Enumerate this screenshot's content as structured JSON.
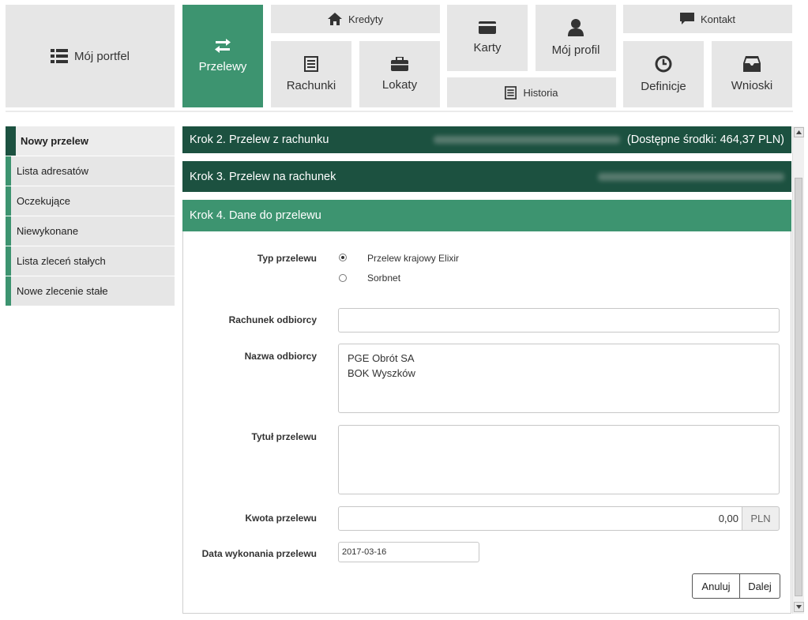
{
  "nav": {
    "portfolio": "Mój portfel",
    "transfers": "Przelewy",
    "credits": "Kredyty",
    "accounts": "Rachunki",
    "deposits": "Lokaty",
    "cards": "Karty",
    "history": "Historia",
    "profile": "Mój profil",
    "contact": "Kontakt",
    "definitions": "Definicje",
    "requests": "Wnioski"
  },
  "sidebar": {
    "items": [
      {
        "label": "Nowy przelew"
      },
      {
        "label": "Lista adresatów"
      },
      {
        "label": "Oczekujące"
      },
      {
        "label": "Niewykonane"
      },
      {
        "label": "Lista zleceń stałych"
      },
      {
        "label": "Nowe zlecenie stałe"
      }
    ]
  },
  "steps": {
    "step2": {
      "title": "Krok 2. Przelew z rachunku",
      "funds": "(Dostępne środki: 464,37 PLN)"
    },
    "step3": {
      "title": "Krok 3. Przelew na rachunek"
    },
    "step4": {
      "title": "Krok 4. Dane do przelewu"
    }
  },
  "form": {
    "transfer_type_label": "Typ przelewu",
    "transfer_types": [
      {
        "label": "Przelew krajowy Elixir",
        "selected": true
      },
      {
        "label": "Sorbnet",
        "selected": false
      }
    ],
    "recipient_account_label": "Rachunek odbiorcy",
    "recipient_account_value": "",
    "recipient_name_label": "Nazwa odbiorcy",
    "recipient_name_value": "PGE Obrót SA\nBOK Wyszków",
    "title_label": "Tytuł przelewu",
    "title_value": "",
    "amount_label": "Kwota przelewu",
    "amount_value": "0,00",
    "currency": "PLN",
    "date_label": "Data wykonania przelewu",
    "date_value": "2017-03-16",
    "cancel_label": "Anuluj",
    "next_label": "Dalej"
  },
  "colors": {
    "accent": "#3d9470",
    "dark_accent": "#1c5140",
    "tile_bg": "#e6e6e6"
  }
}
